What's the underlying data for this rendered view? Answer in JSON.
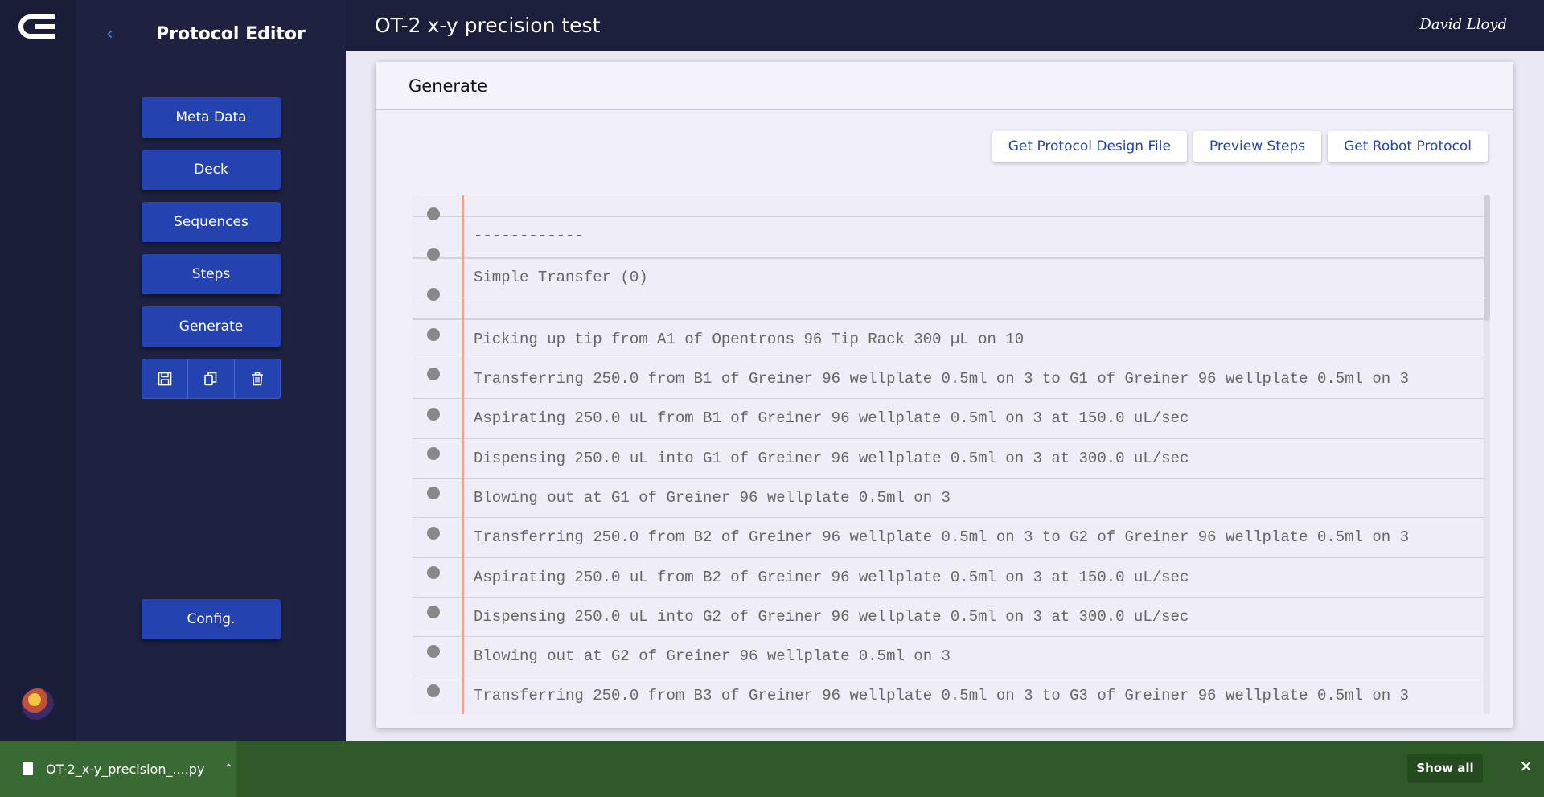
{
  "sidebar": {
    "title": "Protocol Editor",
    "nav": [
      "Meta Data",
      "Deck",
      "Sequences",
      "Steps",
      "Generate"
    ],
    "config_label": "Config.",
    "tools": [
      "save-icon",
      "copy-icon",
      "delete-icon"
    ]
  },
  "header": {
    "title": "OT-2 x-y precision test",
    "user_signature": "David Lloyd"
  },
  "main": {
    "card_title": "Generate",
    "actions": [
      "Get Protocol Design File",
      "Preview Steps",
      "Get Robot Protocol"
    ],
    "log_lines": [
      "",
      "------------",
      "",
      "Simple Transfer (0)",
      "",
      "",
      "Picking up tip from A1 of Opentrons 96 Tip Rack 300 µL on 10",
      "Transferring 250.0 from B1 of Greiner 96 wellplate 0.5ml on 3 to G1 of Greiner 96 wellplate 0.5ml on 3",
      "Aspirating 250.0 uL from B1 of Greiner 96 wellplate 0.5ml on 3 at 150.0 uL/sec",
      "Dispensing 250.0 uL into G1 of Greiner 96 wellplate 0.5ml on 3 at 300.0 uL/sec",
      "Blowing out at G1 of Greiner 96 wellplate 0.5ml on 3",
      "Transferring 250.0 from B2 of Greiner 96 wellplate 0.5ml on 3 to G2 of Greiner 96 wellplate 0.5ml on 3",
      "Aspirating 250.0 uL from B2 of Greiner 96 wellplate 0.5ml on 3 at 150.0 uL/sec",
      "Dispensing 250.0 uL into G2 of Greiner 96 wellplate 0.5ml on 3 at 300.0 uL/sec",
      "Blowing out at G2 of Greiner 96 wellplate 0.5ml on 3",
      "Transferring 250.0 from B3 of Greiner 96 wellplate 0.5ml on 3 to G3 of Greiner 96 wellplate 0.5ml on 3"
    ]
  },
  "download_bar": {
    "file_name": "OT-2_x-y_precision_....py",
    "show_all_label": "Show all"
  },
  "colors": {
    "primary_button": "#2442b0",
    "background": "#1c1f3b",
    "download_bar": "#2e5a28",
    "margin_line": "#f2a08f"
  }
}
